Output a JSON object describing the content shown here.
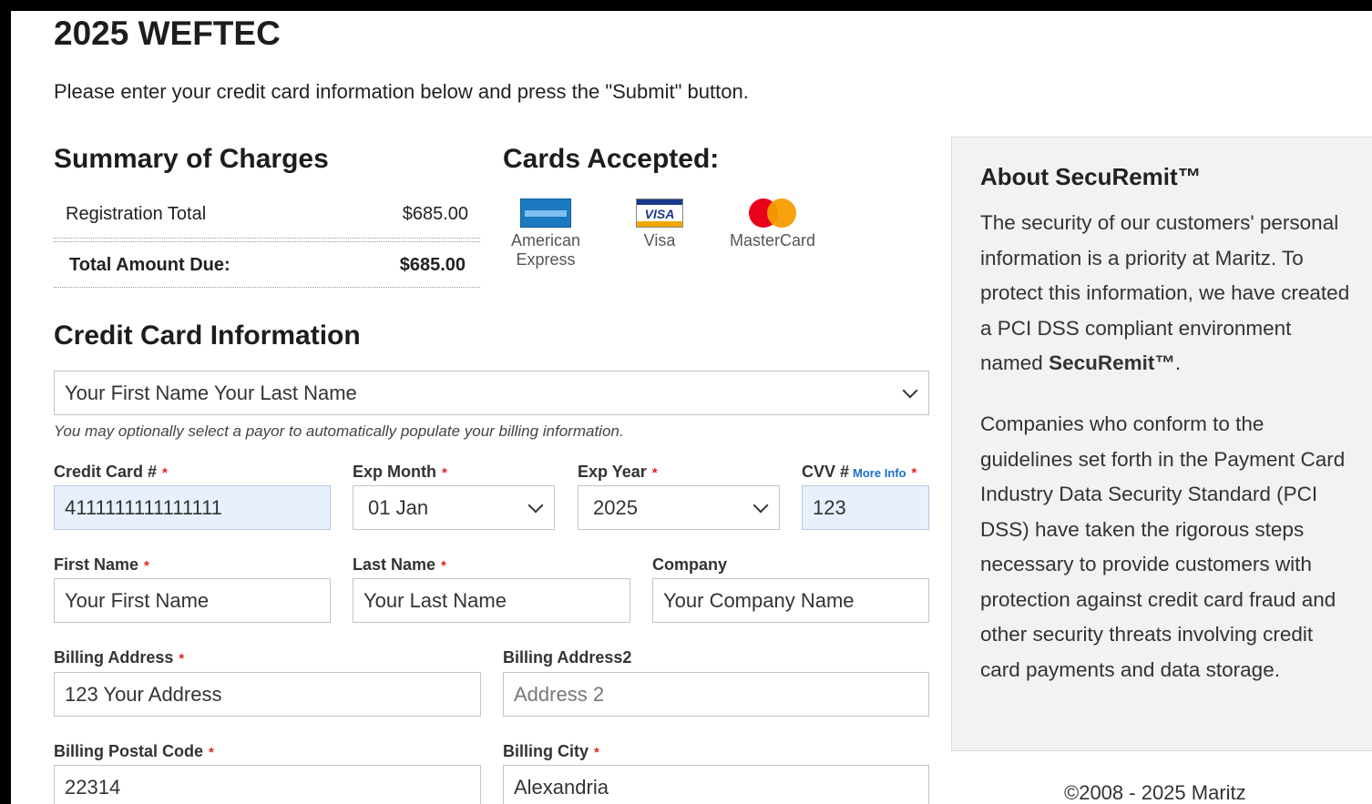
{
  "page": {
    "title": "2025 WEFTEC",
    "intro": "Please enter your credit card information below and press the \"Submit\" button."
  },
  "summary": {
    "heading": "Summary of Charges",
    "rows": [
      {
        "label": "Registration Total",
        "value": "$685.00"
      },
      {
        "label": "Total Amount Due:",
        "value": "$685.00"
      }
    ]
  },
  "cards": {
    "heading": "Cards Accepted:",
    "items": [
      {
        "name": "American Express",
        "line1": "American",
        "line2": "Express",
        "icon": "amex-icon"
      },
      {
        "name": "Visa",
        "line1": "Visa",
        "icon": "visa-icon",
        "logo_text": "VISA"
      },
      {
        "name": "MasterCard",
        "line1": "MasterCard",
        "icon": "mastercard-icon"
      }
    ]
  },
  "cc": {
    "heading": "Credit Card Information",
    "payor_select": "Your First Name Your Last Name",
    "hint": "You may optionally select a payor to automatically populate your billing information.",
    "credit_card": {
      "label": "Credit Card #",
      "value": "4111111111111111"
    },
    "exp_month": {
      "label": "Exp Month",
      "value": "01 Jan"
    },
    "exp_year": {
      "label": "Exp Year",
      "value": "2025"
    },
    "cvv": {
      "label": "CVV #",
      "more_info": "More Info",
      "value": "123"
    },
    "first_name": {
      "label": "First Name",
      "value": "Your First Name"
    },
    "last_name": {
      "label": "Last Name",
      "value": "Your Last Name"
    },
    "company": {
      "label": "Company",
      "value": "Your Company Name"
    },
    "address1": {
      "label": "Billing Address",
      "value": "123 Your Address"
    },
    "address2": {
      "label": "Billing Address2",
      "placeholder": "Address 2"
    },
    "postal": {
      "label": "Billing Postal Code",
      "value": "22314"
    },
    "city": {
      "label": "Billing City",
      "value": "Alexandria"
    },
    "required_mark": "*"
  },
  "sidebar": {
    "heading": "About SecuRemit™",
    "p1_text": "The security of our customers' personal information is a priority at Maritz. To protect this information, we have created a PCI DSS compliant environment named ",
    "p1_bold": "SecuRemit™",
    "p1_end": ".",
    "p2": "Companies who conform to the guidelines set forth in the Payment Card Industry Data Security Standard (PCI DSS) have taken the rigorous steps necessary to provide customers with protection against credit card fraud and other security threats involving credit card payments and data storage."
  },
  "footer": {
    "copyright": "©2008 - 2025 Maritz"
  },
  "colors": {
    "required": "#e2231a",
    "link": "#1a6fd0",
    "autofill": "#e8f0fe",
    "sidebar_bg": "#f2f2f2"
  }
}
